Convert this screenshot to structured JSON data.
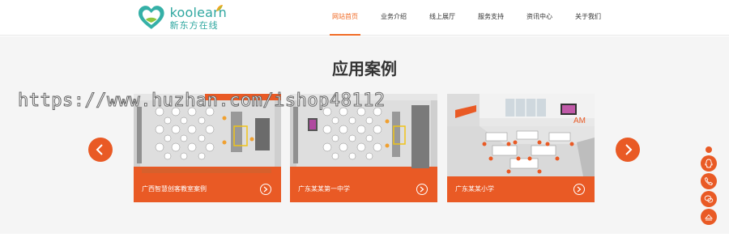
{
  "logo": {
    "brand_en": "koolearn",
    "brand_cn": "新东方在线"
  },
  "nav": [
    {
      "label": "网站首页",
      "active": true
    },
    {
      "label": "业务介绍",
      "active": false
    },
    {
      "label": "线上展厅",
      "active": false
    },
    {
      "label": "服务支持",
      "active": false
    },
    {
      "label": "资讯中心",
      "active": false
    },
    {
      "label": "关于我们",
      "active": false
    }
  ],
  "section": {
    "title": "应用案例"
  },
  "cases": [
    {
      "label": "广西智慧创客教室案例"
    },
    {
      "label": "广东某某第一中学"
    },
    {
      "label": "广东某某小学"
    }
  ],
  "watermark": "https://www.huzhan.com/ishop48112",
  "carousel": {
    "prev_icon": "chevron-left-icon",
    "next_icon": "chevron-right-icon"
  },
  "side_tools": [
    {
      "icon": "qq-icon"
    },
    {
      "icon": "phone-icon"
    },
    {
      "icon": "wechat-icon"
    },
    {
      "icon": "back-to-top-icon"
    }
  ],
  "colors": {
    "accent": "#e95a25",
    "brand_teal": "#2fa7a0",
    "section_bg": "#f5f5f5"
  }
}
